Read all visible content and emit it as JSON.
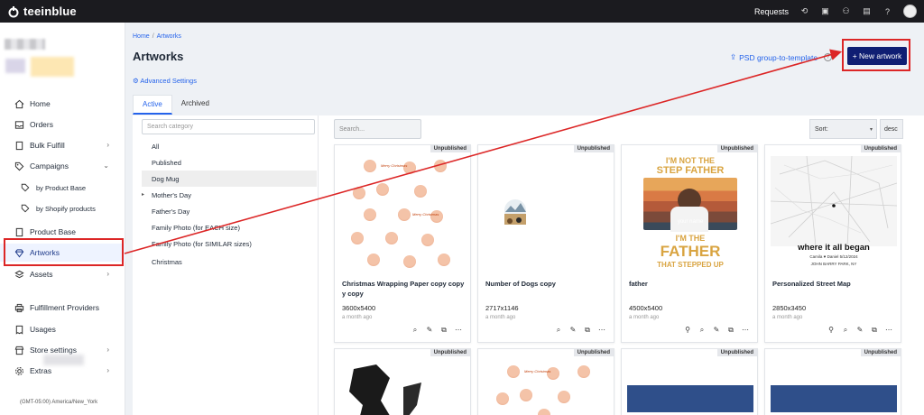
{
  "topbar": {
    "brand": "teeinblue",
    "requests_label": "Requests",
    "icons": [
      "history-icon",
      "box-icon",
      "users-icon",
      "chat-icon",
      "help-icon"
    ]
  },
  "sidebar": {
    "items": [
      {
        "label": "Home",
        "icon": "home-icon"
      },
      {
        "label": "Orders",
        "icon": "inbox-icon"
      },
      {
        "label": "Bulk Fulfill",
        "icon": "document-icon",
        "chevron": "›"
      },
      {
        "label": "Campaigns",
        "icon": "tag-icon",
        "chevron": "⌄"
      },
      {
        "label": "by Product Base",
        "icon": "tag-icon"
      },
      {
        "label": "by Shopify products",
        "icon": "tag-icon"
      },
      {
        "label": "Product Base",
        "icon": "document-icon"
      },
      {
        "label": "Artworks",
        "icon": "diamond-icon"
      },
      {
        "label": "Assets",
        "icon": "layers-icon",
        "chevron": "›"
      },
      {
        "label": "Fulfillment Providers",
        "icon": "printer-icon"
      },
      {
        "label": "Usages",
        "icon": "receipt-icon"
      },
      {
        "label": "Store settings",
        "icon": "store-icon",
        "chevron": "›"
      },
      {
        "label": "Extras",
        "icon": "gear-icon",
        "chevron": "›"
      }
    ],
    "timezone": "(GMT-05:00) America/New_York"
  },
  "main": {
    "breadcrumb": {
      "home": "Home",
      "sep": "/",
      "current": "Artworks"
    },
    "title": "Artworks",
    "advanced_settings": "Advanced Settings",
    "psd_link": "PSD group-to-template",
    "new_artwork": "+ New artwork",
    "tabs": [
      "Active",
      "Archived"
    ],
    "category_search_placeholder": "Search category",
    "categories": [
      "All",
      "Published",
      "Dog Mug",
      "Mother's Day",
      "Father's Day",
      "Family Photo (for EACH size)",
      "Family Photo (for SIMILAR sizes)",
      "Christmas"
    ],
    "grid_search_placeholder": "Search...",
    "sort_label": "Sort:",
    "sort_dir": "desc",
    "badge": "Unpublished",
    "cards": [
      {
        "name": "Christmas Wrapping Paper copy copy y copy",
        "size": "3600x5400",
        "time": "a month ago"
      },
      {
        "name": "Number of Dogs copy",
        "size": "2717x1146",
        "time": "a month ago"
      },
      {
        "name": "father",
        "size": "4500x5400",
        "time": "a month ago"
      },
      {
        "name": "Personalized Street Map",
        "size": "2850x3450",
        "time": "a month ago"
      }
    ],
    "father_art": {
      "line1": "I'M NOT THE",
      "line2": "STEP FATHER",
      "line3": "I'M THE",
      "line4": "FATHER",
      "line5": "THAT STEPPED UP",
      "name": "your name"
    },
    "map_art": {
      "title": "where it all began",
      "sub": "Camila  ♥  Daniel   5/12/2024",
      "place": "JOHN BARRY PARK, NY"
    },
    "greeting": "Merry Christmas"
  },
  "colors": {
    "accent": "#2563eb",
    "primary_button": "#0f1e73",
    "annotation": "#dc2626",
    "topbar": "#1b1b1f"
  }
}
